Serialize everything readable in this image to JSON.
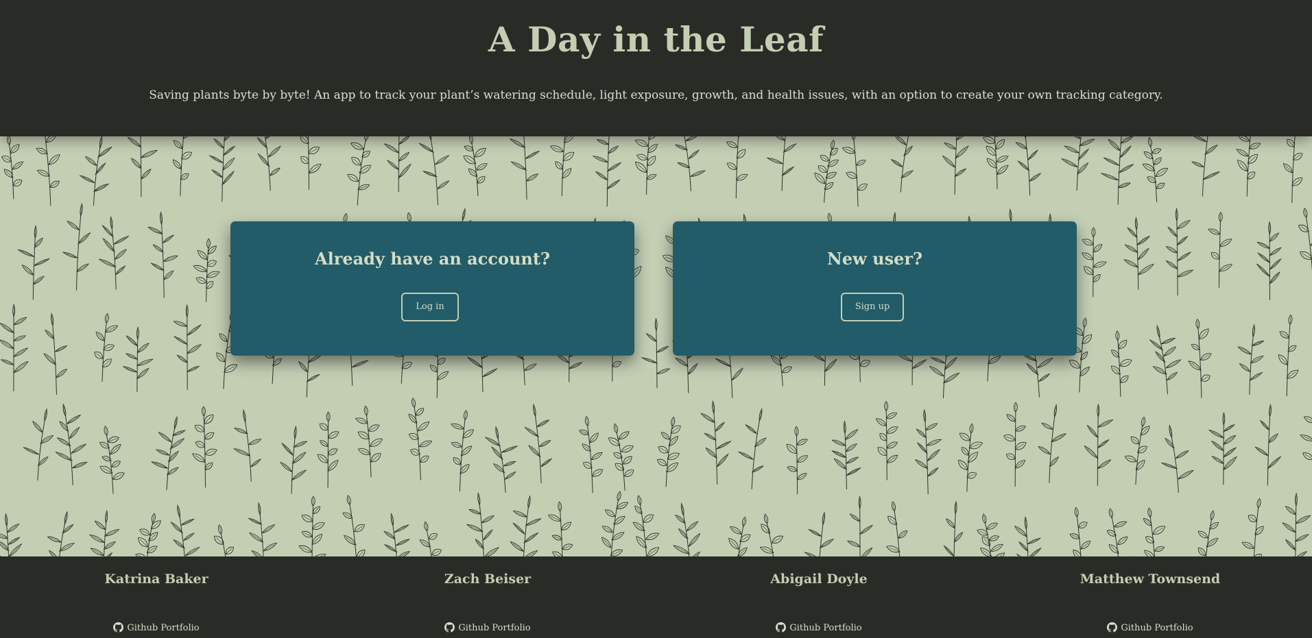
{
  "header": {
    "title": "A Day in the Leaf",
    "tagline": "Saving plants byte by byte! An app to track your plant’s watering schedule, light exposure, growth, and health issues, with an option to create your own tracking category."
  },
  "cards": {
    "login": {
      "heading": "Already have an account?",
      "button": "Log in"
    },
    "signup": {
      "heading": "New user?",
      "button": "Sign up"
    }
  },
  "footer": {
    "members": [
      {
        "name": "Katrina Baker",
        "link_label": "Github Portfolio",
        "icon": "github-icon"
      },
      {
        "name": "Zach Beiser",
        "link_label": "Github Portfolio",
        "icon": "github-icon"
      },
      {
        "name": "Abigail Doyle",
        "link_label": "Github Portfolio",
        "icon": "github-icon"
      },
      {
        "name": "Matthew Townsend",
        "link_label": "Github Portfolio",
        "icon": "github-icon"
      }
    ]
  },
  "colors": {
    "dark": "#292c26",
    "sage": "#c3ceb3",
    "teal": "#215c68",
    "line": "#2e3229"
  }
}
